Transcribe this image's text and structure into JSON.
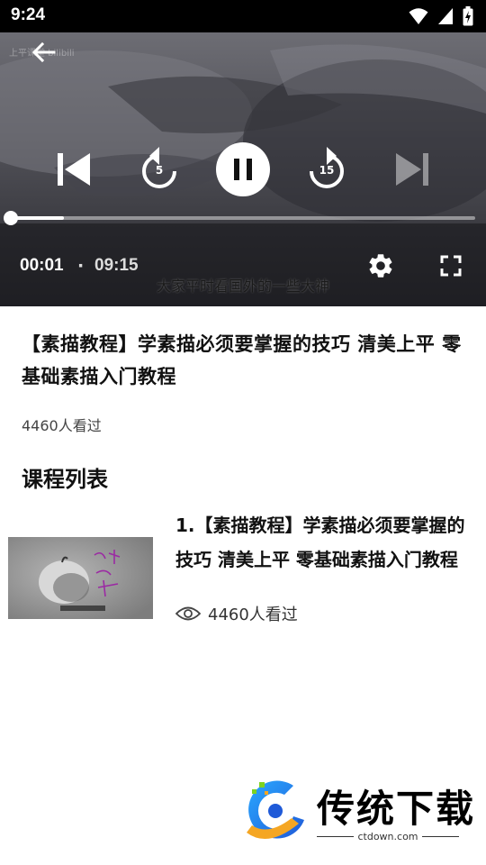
{
  "status_bar": {
    "time": "9:24"
  },
  "player": {
    "watermark": "上平课堂 bilibili",
    "rewind_seconds": "5",
    "forward_seconds": "15",
    "current_time": "00:01",
    "separator": "·",
    "total_time": "09:15",
    "progress": 0.115,
    "subtitle": "大家平时看国外的一些大神"
  },
  "course": {
    "title": "【素描教程】学素描必须要掌握的技巧 清美上平 零基础素描入门教程",
    "views": "4460人看过"
  },
  "section": {
    "title": "课程列表"
  },
  "lessons": [
    {
      "title": "1.【素描教程】学素描必须要掌握的技巧 清美上平 零基础素描入门教程",
      "views": "4460人看过"
    }
  ],
  "brand": {
    "name": "传统下载",
    "url": "ctdown.com"
  },
  "icons": {
    "back": "arrow-left-icon",
    "prev": "skip-previous-icon",
    "rewind": "replay-5-icon",
    "pause": "pause-icon",
    "forward": "forward-15-icon",
    "next": "skip-next-icon",
    "settings": "gear-icon",
    "fullscreen": "fullscreen-icon",
    "views": "eye-icon"
  }
}
